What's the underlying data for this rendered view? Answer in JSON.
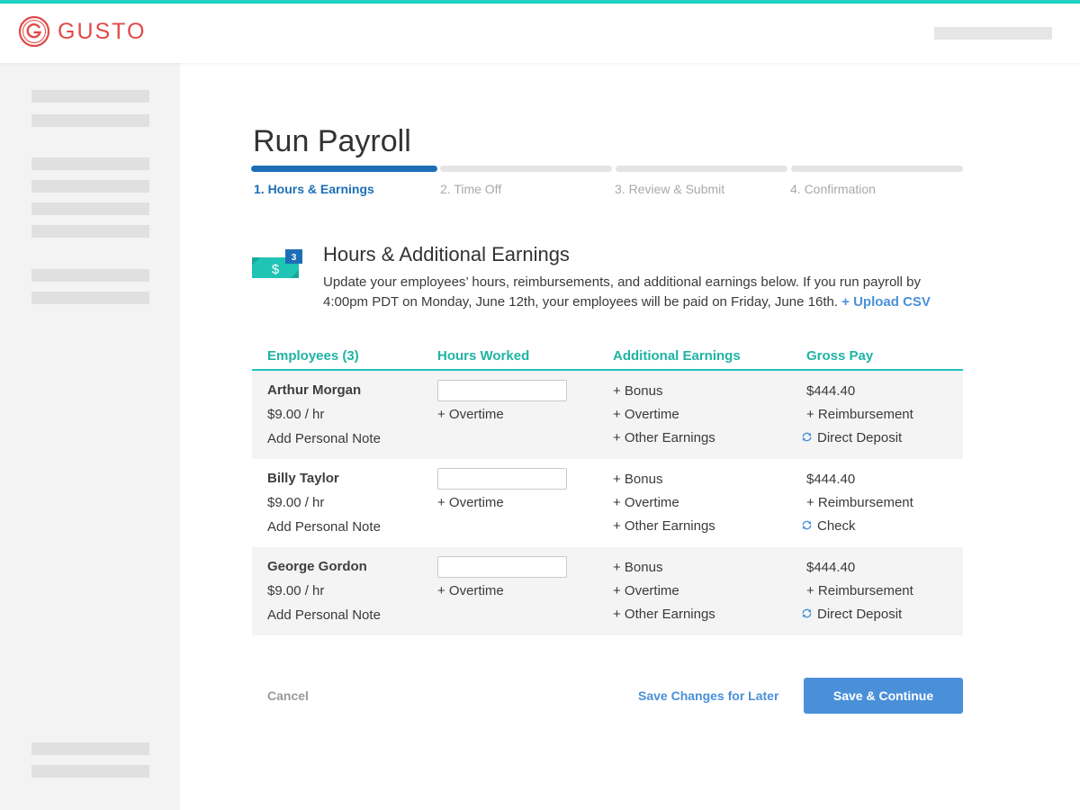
{
  "app": {
    "brand": "GUSTO",
    "accent": "#1fd1c1",
    "brand_color": "#e04a48"
  },
  "page": {
    "title": "Run Payroll"
  },
  "steps": [
    {
      "label": "1. Hours & Earnings",
      "active": true
    },
    {
      "label": "2. Time Off",
      "active": false
    },
    {
      "label": "3. Review & Submit",
      "active": false
    },
    {
      "label": "4. Confirmation",
      "active": false
    }
  ],
  "section": {
    "icon": "money-icon",
    "badge": "3",
    "title": "Hours & Additional Earnings",
    "description": "Update your employees’ hours, reimbursements, and additional earnings below. If you run payroll by 4:00pm PDT on Monday, June 12th, your employees will be paid on Friday, June 16th.",
    "upload_link": "+ Upload CSV"
  },
  "table": {
    "headers": {
      "employees": "Employees (3)",
      "hours": "Hours Worked",
      "earnings": "Additional Earnings",
      "gross": "Gross Pay"
    },
    "rows": [
      {
        "name": "Arthur Morgan",
        "rate": "$9.00 / hr",
        "note": "Add Personal Note",
        "hours_value": "",
        "overtime": "+ Overtime",
        "bonus": "+ Bonus",
        "earn_overtime": "+ Overtime",
        "other": "+ Other Earnings",
        "gross": "$444.40",
        "reimbursement": "+ Reimbursement",
        "payment": "Direct Deposit"
      },
      {
        "name": "Billy Taylor",
        "rate": "$9.00 / hr",
        "note": "Add Personal Note",
        "hours_value": "",
        "overtime": "+ Overtime",
        "bonus": "+ Bonus",
        "earn_overtime": "+ Overtime",
        "other": "+ Other Earnings",
        "gross": "$444.40",
        "reimbursement": "+ Reimbursement",
        "payment": "Check"
      },
      {
        "name": "George Gordon",
        "rate": "$9.00 / hr",
        "note": "Add Personal Note",
        "hours_value": "",
        "overtime": "+ Overtime",
        "bonus": "+ Bonus",
        "earn_overtime": "+ Overtime",
        "other": "+ Other Earnings",
        "gross": "$444.40",
        "reimbursement": "+ Reimbursement",
        "payment": "Direct Deposit"
      }
    ]
  },
  "actions": {
    "cancel": "Cancel",
    "save_later": "Save Changes for Later",
    "save_continue": "Save & Continue"
  }
}
